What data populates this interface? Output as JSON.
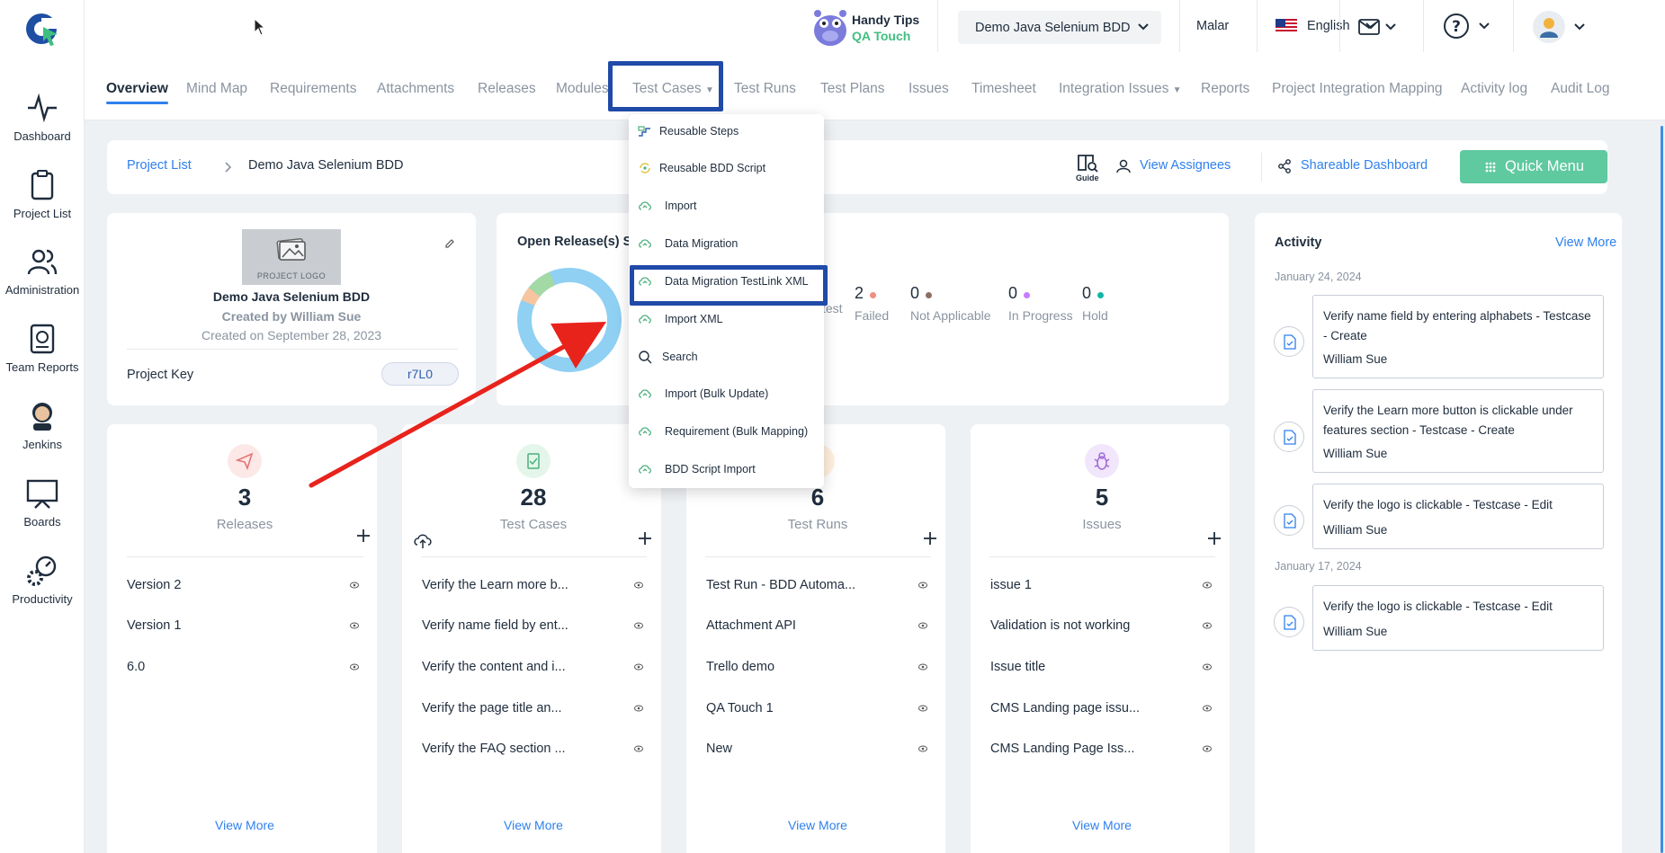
{
  "topbar": {
    "mascot_title": "Handy Tips",
    "mascot_sub": "QA Touch",
    "project_select": "Demo Java Selenium BDD",
    "user_name": "Malar",
    "language": "English"
  },
  "sidebar": {
    "items": [
      {
        "label": "Dashboard",
        "icon": "activity-icon"
      },
      {
        "label": "Project List",
        "icon": "clipboard-icon"
      },
      {
        "label": "Administration",
        "icon": "users-icon"
      },
      {
        "label": "Team Reports",
        "icon": "report-icon"
      },
      {
        "label": "Jenkins",
        "icon": "jenkins-icon"
      },
      {
        "label": "Boards",
        "icon": "board-icon"
      },
      {
        "label": "Productivity",
        "icon": "productivity-icon"
      }
    ]
  },
  "tabs": [
    "Overview",
    "Mind Map",
    "Requirements",
    "Attachments",
    "Releases",
    "Modules",
    "Test Cases",
    "Test Runs",
    "Test Plans",
    "Issues",
    "Timesheet",
    "Integration Issues",
    "Reports",
    "Project Integration Mapping",
    "Activity log",
    "Audit Log"
  ],
  "breadcrumb": {
    "root": "Project List",
    "current": "Demo Java Selenium BDD"
  },
  "header_actions": {
    "guide": "Guide",
    "view_assignees": "View Assignees",
    "shareable": "Shareable Dashboard",
    "quick_menu": "Quick Menu"
  },
  "project_card": {
    "logo_text": "PROJECT LOGO",
    "name": "Demo Java Selenium BDD",
    "created_by": "Created by William Sue",
    "created_on": "Created on September 28, 2023",
    "key_label": "Project Key",
    "key_value": "r7L0"
  },
  "release_status": {
    "title": "Open Release(s) St",
    "items": [
      {
        "count": "2",
        "label": "Failed",
        "color": "#f28b82"
      },
      {
        "count": "0",
        "label": "Not Applicable",
        "color": "#8d6e63"
      },
      {
        "count": "0",
        "label": "In Progress",
        "color": "#c77dff"
      },
      {
        "count": "0",
        "label": "Hold",
        "color": "#12b5a5"
      }
    ],
    "partial_label": "test"
  },
  "dropdown": {
    "items": [
      "Reusable Steps",
      "Reusable BDD Script",
      "Import",
      "Data Migration",
      "Data Migration TestLink XML",
      "Import XML",
      "Search",
      "Import (Bulk Update)",
      "Requirement (Bulk Mapping)",
      "BDD Script Import"
    ]
  },
  "stats": [
    {
      "count": "3",
      "label": "Releases",
      "items": [
        "Version 2",
        "Version 1",
        "6.0"
      ],
      "view_more": "View More"
    },
    {
      "count": "28",
      "label": "Test Cases",
      "items": [
        "Verify the Learn more b...",
        "Verify name field by ent...",
        "Verify the content and i...",
        "Verify the page title an...",
        "Verify the FAQ section ..."
      ],
      "view_more": "View More"
    },
    {
      "count": "6",
      "label": "Test Runs",
      "items": [
        "Test Run - BDD Automa...",
        "Attachment API",
        "Trello demo",
        "QA Touch 1",
        "New"
      ],
      "view_more": "View More"
    },
    {
      "count": "5",
      "label": "Issues",
      "items": [
        "issue 1",
        "Validation is not working",
        "Issue title",
        "CMS Landing page issu...",
        "CMS Landing Page Iss..."
      ],
      "view_more": "View More"
    }
  ],
  "activity": {
    "title": "Activity",
    "view_more": "View More",
    "groups": [
      {
        "date": "January 24, 2024",
        "entries": [
          {
            "title": "Verify name field by entering alphabets - Testcase - Create",
            "user": "William Sue"
          },
          {
            "title": "Verify the Learn more button is clickable under features section - Testcase - Create",
            "user": "William Sue"
          },
          {
            "title": "Verify the logo is clickable - Testcase - Edit",
            "user": "William Sue"
          }
        ]
      },
      {
        "date": "January 17, 2024",
        "entries": [
          {
            "title": "Verify the logo is clickable - Testcase - Edit",
            "user": "William Sue"
          }
        ]
      }
    ]
  },
  "colors": {
    "accent": "#2f80ed",
    "quick_menu": "#5fc9a0",
    "highlight": "#1f4aa8",
    "arrow": "#e8231c",
    "donut": "#8fd0f3"
  }
}
